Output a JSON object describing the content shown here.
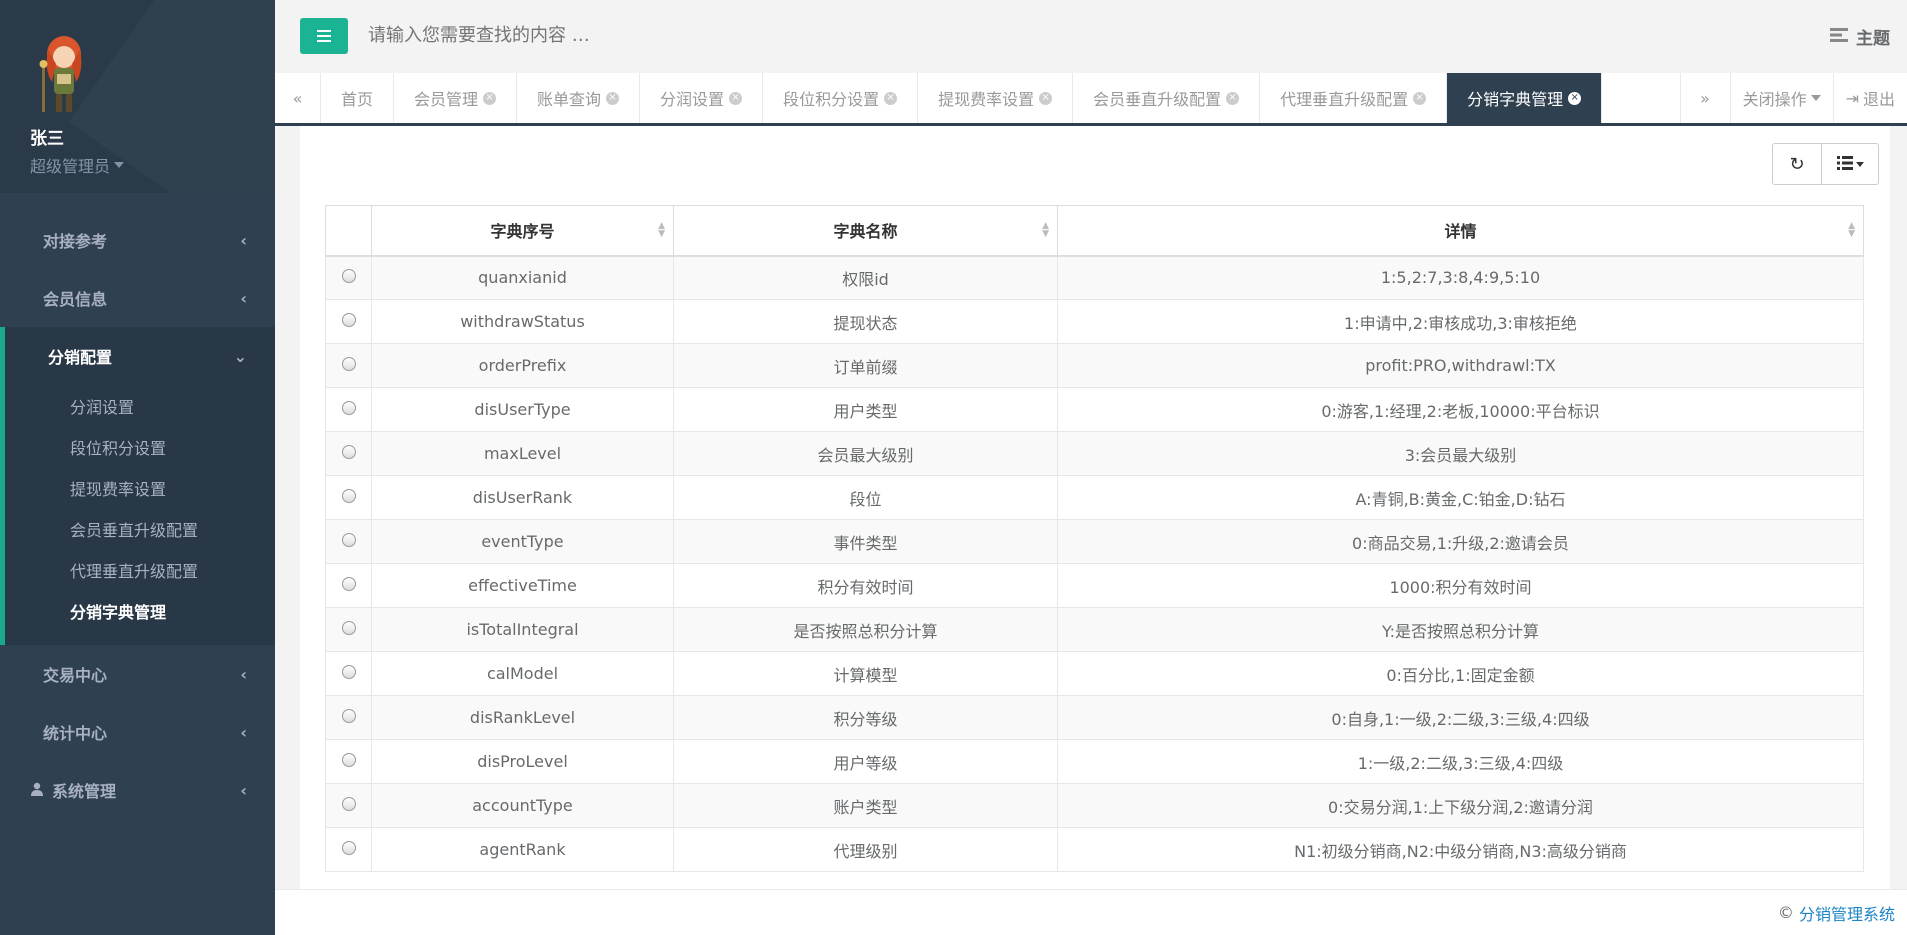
{
  "user": {
    "name": "张三",
    "role": "超级管理员"
  },
  "sidebar": {
    "items_top": [
      {
        "label": "对接参考"
      },
      {
        "label": "会员信息"
      }
    ],
    "active_group": {
      "label": "分销配置",
      "children": [
        {
          "label": "分润设置"
        },
        {
          "label": "段位积分设置"
        },
        {
          "label": "提现费率设置"
        },
        {
          "label": "会员垂直升级配置"
        },
        {
          "label": "代理垂直升级配置"
        },
        {
          "label": "分销字典管理"
        }
      ]
    },
    "items_bottom": [
      {
        "label": "交易中心"
      },
      {
        "label": "统计中心"
      },
      {
        "label": "系统管理"
      }
    ]
  },
  "header": {
    "search_placeholder": "请输入您需要查找的内容 …",
    "theme_label": "主题"
  },
  "tabs": [
    {
      "label": "首页"
    },
    {
      "label": "会员管理"
    },
    {
      "label": "账单查询"
    },
    {
      "label": "分润设置"
    },
    {
      "label": "段位积分设置"
    },
    {
      "label": "提现费率设置"
    },
    {
      "label": "会员垂直升级配置"
    },
    {
      "label": "代理垂直升级配置"
    },
    {
      "label": "分销字典管理"
    }
  ],
  "tab_controls": {
    "close_ops": "关闭操作",
    "logout": "退出"
  },
  "table": {
    "headers": [
      "字典序号",
      "字典名称",
      "详情"
    ],
    "rows": [
      [
        "quanxianid",
        "权限id",
        "1:5,2:7,3:8,4:9,5:10"
      ],
      [
        "withdrawStatus",
        "提现状态",
        "1:申请中,2:审核成功,3:审核拒绝"
      ],
      [
        "orderPrefix",
        "订单前缀",
        "profit:PRO,withdrawl:TX"
      ],
      [
        "disUserType",
        "用户类型",
        "0:游客,1:经理,2:老板,10000:平台标识"
      ],
      [
        "maxLevel",
        "会员最大级别",
        "3:会员最大级别"
      ],
      [
        "disUserRank",
        "段位",
        "A:青铜,B:黄金,C:铂金,D:钻石"
      ],
      [
        "eventType",
        "事件类型",
        "0:商品交易,1:升级,2:邀请会员"
      ],
      [
        "effectiveTime",
        "积分有效时间",
        "1000:积分有效时间"
      ],
      [
        "isTotalIntegral",
        "是否按照总积分计算",
        "Y:是否按照总积分计算"
      ],
      [
        "calModel",
        "计算模型",
        "0:百分比,1:固定金额"
      ],
      [
        "disRankLevel",
        "积分等级",
        "0:自身,1:一级,2:二级,3:三级,4:四级"
      ],
      [
        "disProLevel",
        "用户等级",
        "1:一级,2:二级,3:三级,4:四级"
      ],
      [
        "accountType",
        "账户类型",
        "0:交易分润,1:上下级分润,2:邀请分润"
      ],
      [
        "agentRank",
        "代理级别",
        "N1:初级分销商,N2:中级分销商,N3:高级分销商"
      ]
    ]
  },
  "footer": {
    "copyright": "©",
    "system_name": "分销管理系统"
  }
}
